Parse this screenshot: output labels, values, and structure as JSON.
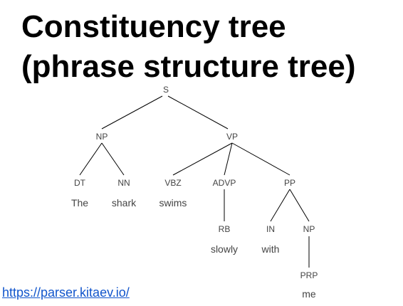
{
  "title": {
    "line1": "Constituency tree",
    "line2": "(phrase structure tree)"
  },
  "tree": {
    "nodes": {
      "s": "S",
      "np1": "NP",
      "vp": "VP",
      "dt": "DT",
      "nn": "NN",
      "vbz": "VBZ",
      "advp": "ADVP",
      "pp": "PP",
      "rb": "RB",
      "in": "IN",
      "np2": "NP",
      "prp": "PRP"
    },
    "words": {
      "the": "The",
      "shark": "shark",
      "swims": "swims",
      "slowly": "slowly",
      "with": "with",
      "me": "me"
    }
  },
  "source_link": "https://parser.kitaev.io/",
  "colors": {
    "title": "#000000",
    "label": "#444444",
    "edge": "#000000",
    "link": "#1155cc"
  }
}
